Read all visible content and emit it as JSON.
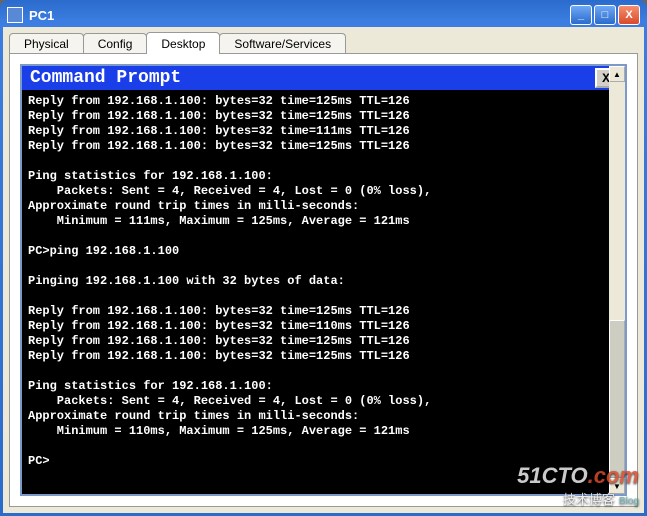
{
  "window": {
    "title": "PC1",
    "minimize": "_",
    "maximize": "□",
    "close": "X"
  },
  "tabs": {
    "items": [
      {
        "label": "Physical",
        "active": false
      },
      {
        "label": "Config",
        "active": false
      },
      {
        "label": "Desktop",
        "active": true
      },
      {
        "label": "Software/Services",
        "active": false
      }
    ]
  },
  "command_prompt": {
    "title": "Command Prompt",
    "close": "X",
    "lines": [
      "Reply from 192.168.1.100: bytes=32 time=125ms TTL=126",
      "Reply from 192.168.1.100: bytes=32 time=125ms TTL=126",
      "Reply from 192.168.1.100: bytes=32 time=111ms TTL=126",
      "Reply from 192.168.1.100: bytes=32 time=125ms TTL=126",
      "",
      "Ping statistics for 192.168.1.100:",
      "    Packets: Sent = 4, Received = 4, Lost = 0 (0% loss),",
      "Approximate round trip times in milli-seconds:",
      "    Minimum = 111ms, Maximum = 125ms, Average = 121ms",
      "",
      "PC>ping 192.168.1.100",
      "",
      "Pinging 192.168.1.100 with 32 bytes of data:",
      "",
      "Reply from 192.168.1.100: bytes=32 time=125ms TTL=126",
      "Reply from 192.168.1.100: bytes=32 time=110ms TTL=126",
      "Reply from 192.168.1.100: bytes=32 time=125ms TTL=126",
      "Reply from 192.168.1.100: bytes=32 time=125ms TTL=126",
      "",
      "Ping statistics for 192.168.1.100:",
      "    Packets: Sent = 4, Received = 4, Lost = 0 (0% loss),",
      "Approximate round trip times in milli-seconds:",
      "    Minimum = 110ms, Maximum = 125ms, Average = 121ms",
      "",
      "PC>"
    ]
  },
  "scrollbar": {
    "up": "▲",
    "down": "▼"
  },
  "watermark": {
    "line1a": "51CTO",
    "line1b": ".com",
    "line2a": "技术博客",
    "line2b": "Blog"
  }
}
